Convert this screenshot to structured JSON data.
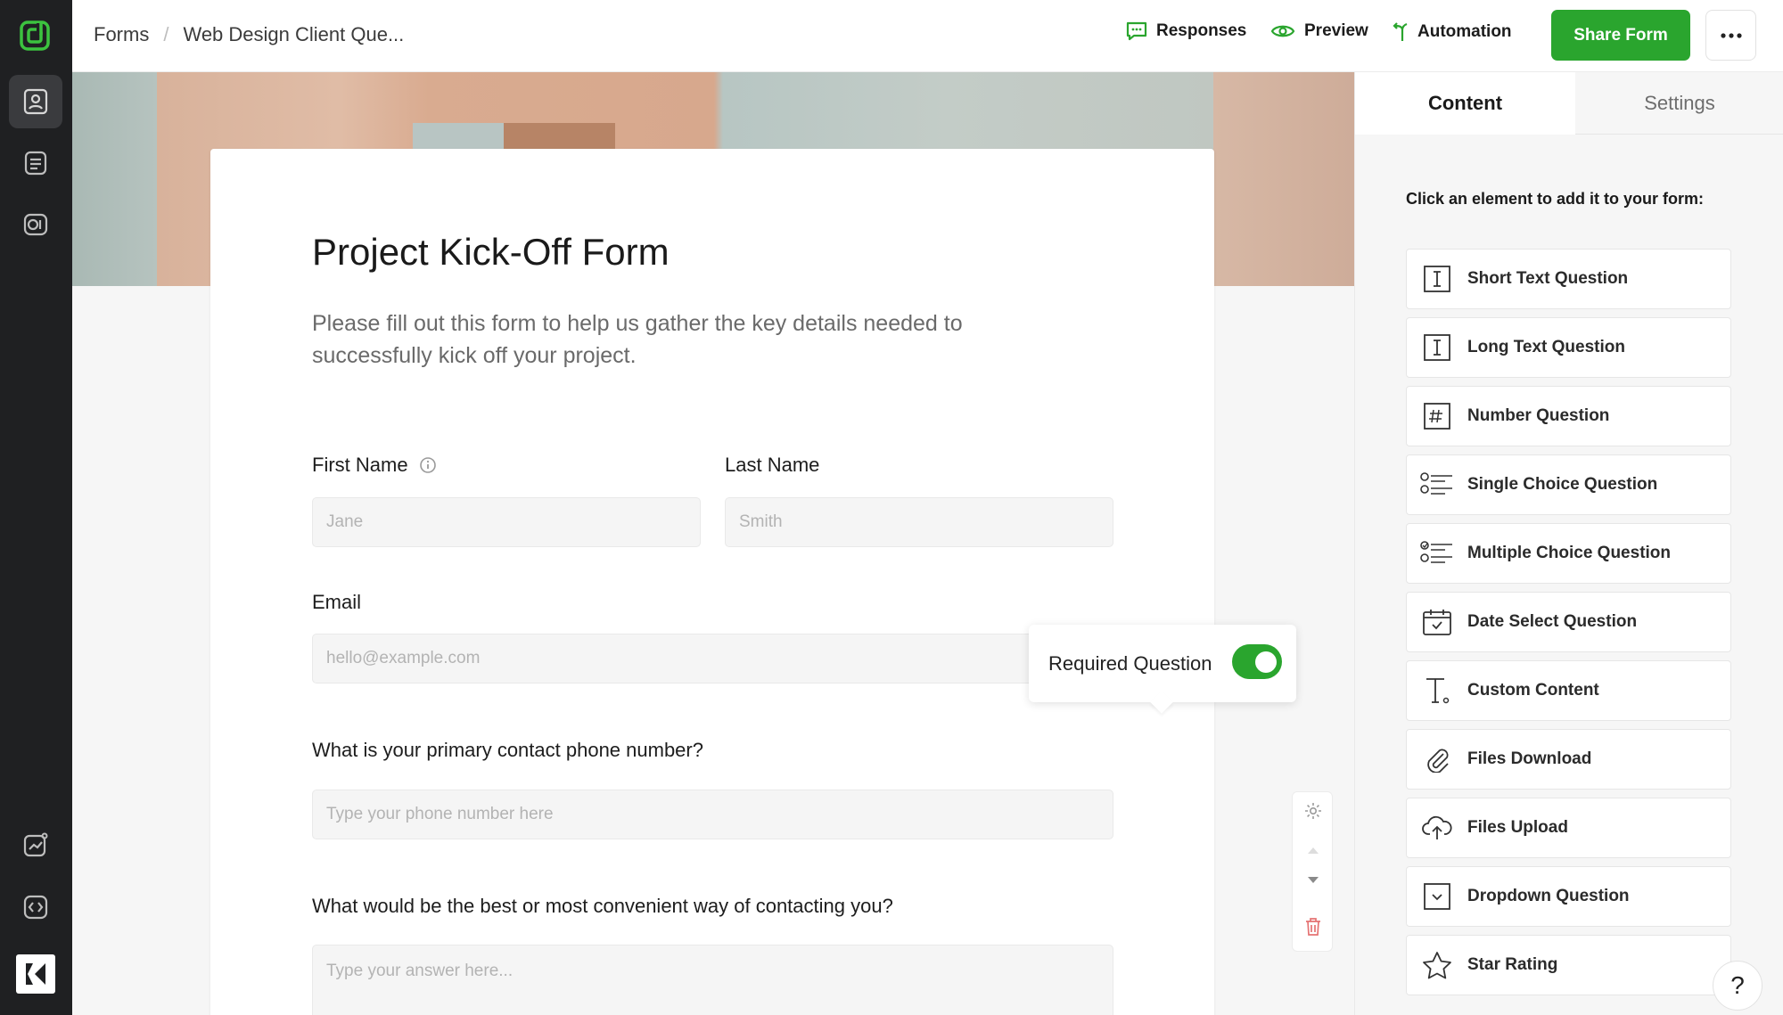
{
  "breadcrumb": {
    "root": "Forms",
    "separator": "/",
    "current": "Web Design Client Que..."
  },
  "topnav": {
    "responses": "Responses",
    "preview": "Preview",
    "automation": "Automation",
    "share": "Share Form"
  },
  "form": {
    "title": "Project Kick-Off Form",
    "description": "Please fill out this form to help us gather the key details needed to successfully kick off your project.",
    "fields": {
      "first_name": {
        "label": "First Name",
        "placeholder": "Jane"
      },
      "last_name": {
        "label": "Last Name",
        "placeholder": "Smith"
      },
      "email": {
        "label": "Email",
        "placeholder": "hello@example.com"
      },
      "phone": {
        "label": "What is your primary contact phone number?",
        "placeholder": "Type your phone number here"
      },
      "contact_way": {
        "label": "What would be the best or most convenient way of contacting you?",
        "placeholder": "Type your answer here..."
      }
    },
    "required_toggle": {
      "label": "Required Question",
      "on": true
    }
  },
  "panel": {
    "tabs": [
      "Content",
      "Settings"
    ],
    "hint": "Click an element to add it to your form:",
    "elements": [
      {
        "label": "Short Text Question",
        "icon": "text-cursor-icon"
      },
      {
        "label": "Long Text Question",
        "icon": "text-cursor-icon"
      },
      {
        "label": "Number Question",
        "icon": "hash-icon"
      },
      {
        "label": "Single Choice Question",
        "icon": "radio-list-icon"
      },
      {
        "label": "Multiple Choice Question",
        "icon": "checkbox-list-icon"
      },
      {
        "label": "Date Select Question",
        "icon": "calendar-icon"
      },
      {
        "label": "Custom Content",
        "icon": "text-t-icon"
      },
      {
        "label": "Files Download",
        "icon": "paperclip-icon"
      },
      {
        "label": "Files Upload",
        "icon": "cloud-upload-icon"
      },
      {
        "label": "Dropdown Question",
        "icon": "dropdown-icon"
      },
      {
        "label": "Star Rating",
        "icon": "star-icon"
      }
    ]
  },
  "help": "?",
  "colors": {
    "accent": "#2aa52e",
    "rail": "#1f2022",
    "danger": "#e57373"
  }
}
